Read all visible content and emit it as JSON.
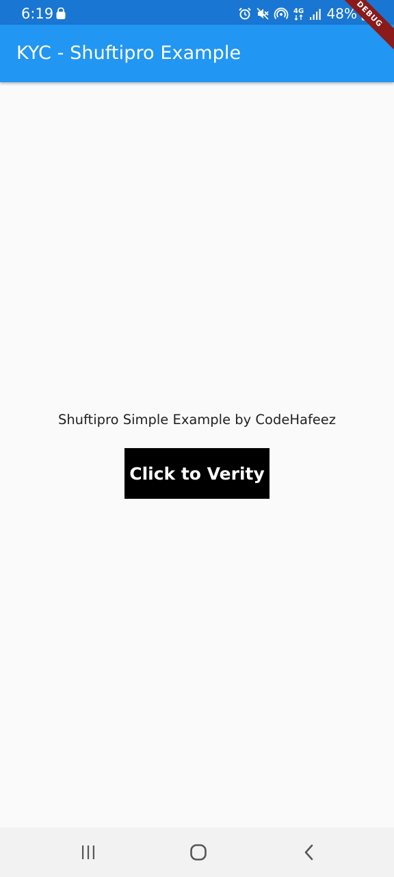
{
  "status_bar": {
    "time": "6:19",
    "battery": "48%",
    "icons": [
      "shopping-bag-icon",
      "alarm-icon",
      "mute-icon",
      "hotspot-icon",
      "4g-icon",
      "signal-icon",
      "battery-icon"
    ],
    "network_label": "4G"
  },
  "app_bar": {
    "title": "KYC - Shuftipro Example",
    "color": "#2196f3"
  },
  "debug_banner": {
    "label": "DEBUG",
    "color": "#8b1a1a"
  },
  "main": {
    "description": "Shuftipro Simple Example by CodeHafeez",
    "button_label": "Click to Verity"
  },
  "nav_bar": {
    "buttons": [
      "recent-apps-icon",
      "home-icon",
      "back-icon"
    ]
  }
}
